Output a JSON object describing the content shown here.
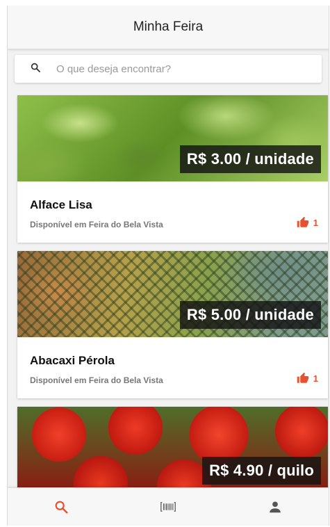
{
  "app": {
    "title": "Minha Feira"
  },
  "search": {
    "placeholder": "O que deseja encontrar?",
    "icon": "search-icon"
  },
  "products": [
    {
      "name": "Alface Lisa",
      "price": "R$ 3.00 / unidade",
      "availability": "Disponível em Feira do Bela Vista",
      "likes": "1",
      "image": "lettuce"
    },
    {
      "name": "Abacaxi Pérola",
      "price": "R$ 5.00 / unidade",
      "availability": "Disponível em Feira do Bela Vista",
      "likes": "1",
      "image": "pineapple"
    },
    {
      "name": "",
      "price": "R$ 4.90 / quilo",
      "availability": "",
      "likes": "",
      "image": "tomato"
    }
  ],
  "bottom_nav": [
    {
      "icon": "search-icon",
      "active": true
    },
    {
      "icon": "barcode-icon",
      "active": false
    },
    {
      "icon": "person-icon",
      "active": false
    }
  ],
  "colors": {
    "accent": "#e8502e",
    "icon_inactive": "#555555"
  }
}
